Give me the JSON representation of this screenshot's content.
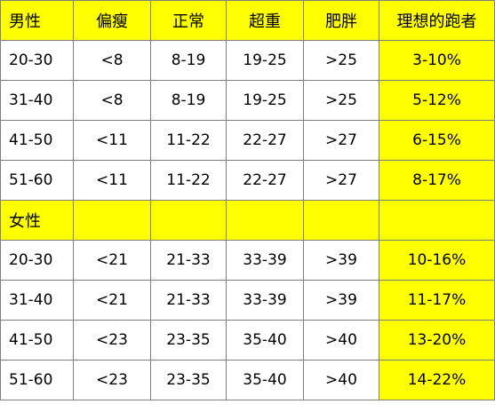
{
  "header": [
    "男性",
    "偏瘦",
    "正常",
    "超重",
    "肥胖",
    "理想的跑者"
  ],
  "male_rows": [
    [
      "20-30",
      "<8",
      "8-19",
      "19-25",
      ">25",
      "3-10%"
    ],
    [
      "31-40",
      "<8",
      "8-19",
      "19-25",
      ">25",
      "5-12%"
    ],
    [
      "41-50",
      "<11",
      "11-22",
      "22-27",
      ">27",
      "6-15%"
    ],
    [
      "51-60",
      "<11",
      "11-22",
      "22-27",
      ">27",
      "8-17%"
    ]
  ],
  "female_label": "女性",
  "female_rows": [
    [
      "20-30",
      "<21",
      "21-33",
      "33-39",
      ">39",
      "10-16%"
    ],
    [
      "31-40",
      "<21",
      "21-33",
      "33-39",
      ">39",
      "11-17%"
    ],
    [
      "41-50",
      "<23",
      "23-35",
      "35-40",
      ">40",
      "13-20%"
    ],
    [
      "51-60",
      "<23",
      "23-35",
      "35-40",
      ">40",
      "14-22%"
    ]
  ],
  "colors": {
    "highlight": "#ffff00",
    "border": "#7f7f7f"
  }
}
